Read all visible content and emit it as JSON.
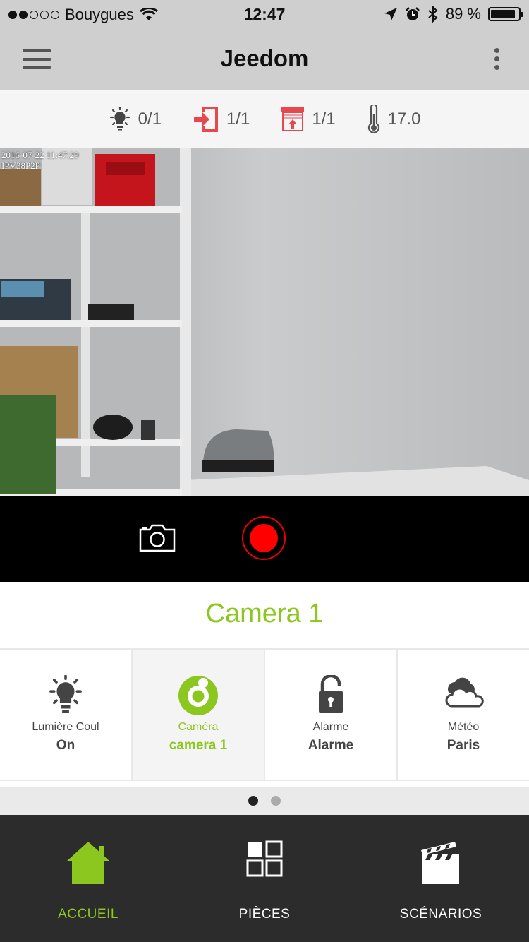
{
  "status_bar": {
    "carrier": "Bouygues",
    "signal_filled": 2,
    "signal_total": 5,
    "time": "12:47",
    "battery_percent": "89 %",
    "battery_level": 0.89
  },
  "nav": {
    "title": "Jeedom",
    "menu_icon": "hamburger-menu-icon",
    "more_icon": "vertical-dots-icon"
  },
  "summary": [
    {
      "icon": "light-bulb-icon",
      "value": "0/1"
    },
    {
      "icon": "door-enter-icon",
      "value": "1/1"
    },
    {
      "icon": "shutter-icon",
      "value": "1/1"
    },
    {
      "icon": "thermometer-icon",
      "value": "17.0"
    }
  ],
  "camera_feed": {
    "timestamp": "2016-07-22 11:47:29",
    "camera_id": "IPV38P2P"
  },
  "camera_controls": {
    "snapshot_icon": "camera-icon",
    "record_icon": "record-icon"
  },
  "widget_section": {
    "title": "Camera 1",
    "tiles": [
      {
        "icon": "light-bulb-icon",
        "label": "Lumière Coul",
        "value": "On",
        "active": false
      },
      {
        "icon": "eye-icon",
        "label": "Caméra",
        "value": "camera 1",
        "active": true
      },
      {
        "icon": "padlock-open-icon",
        "label": "Alarme",
        "value": "Alarme",
        "active": false
      },
      {
        "icon": "cloud-sun-icon",
        "label": "Météo",
        "value": "Paris",
        "active": false
      }
    ],
    "page_current": 1,
    "page_total": 2
  },
  "tabbar": [
    {
      "label": "ACCUEIL",
      "icon": "home-icon",
      "active": true
    },
    {
      "label": "PIÈCES",
      "icon": "grid-icon",
      "active": false
    },
    {
      "label": "SCÉNARIOS",
      "icon": "clapperboard-icon",
      "active": false
    }
  ],
  "colors": {
    "accent": "#8cc71f",
    "alert_red": "#e8474f",
    "record_red": "#ff0000",
    "tabbar_bg": "#2c2c2c",
    "navbar_bg": "#cfcfcf"
  }
}
